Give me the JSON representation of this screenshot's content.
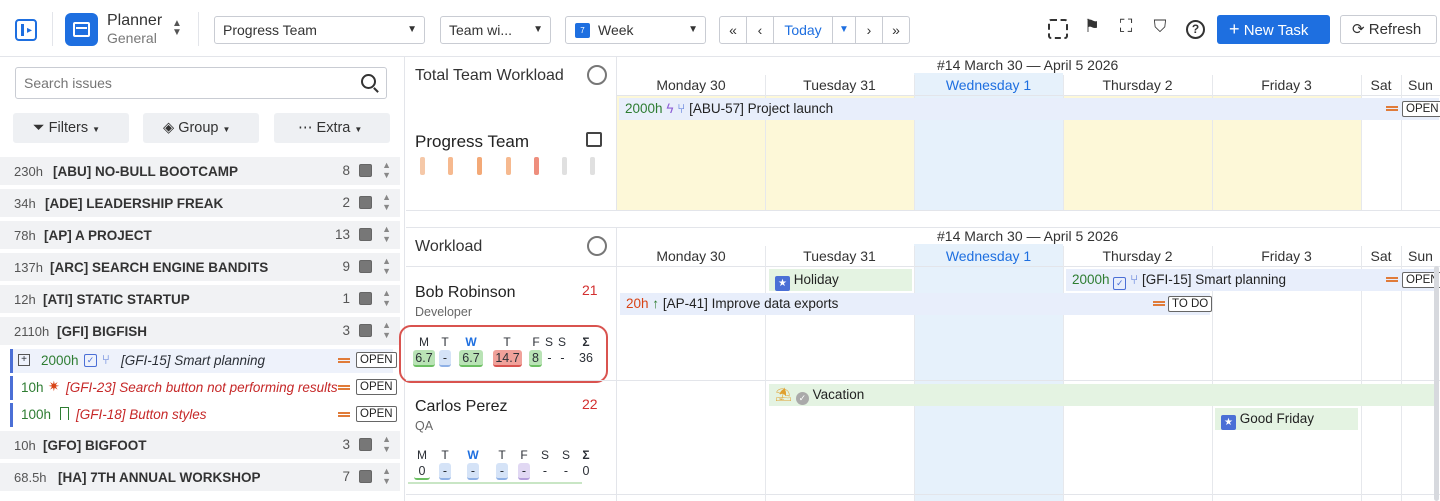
{
  "app": {
    "title": "Planner",
    "subtitle": "General"
  },
  "toolbar": {
    "team_select": "Progress Team",
    "view_select": "Team wi...",
    "period_select": "Week",
    "today": "Today",
    "new_task": "New Task",
    "refresh": "Refresh"
  },
  "sidebar": {
    "search_placeholder": "Search issues",
    "filters": "Filters",
    "group": "Group",
    "extra": "Extra",
    "projects": [
      {
        "hours": "230h",
        "name": "[ABU] NO-BULL BOOTCAMP",
        "count": "8"
      },
      {
        "hours": "34h",
        "name": "[ADE] LEADERSHIP FREAK",
        "count": "2"
      },
      {
        "hours": "78h",
        "name": "[AP] A PROJECT",
        "count": "13"
      },
      {
        "hours": "137h",
        "name": "[ARC] SEARCH ENGINE BANDITS",
        "count": "9"
      },
      {
        "hours": "12h",
        "name": "[ATI] STATIC STARTUP",
        "count": "1"
      },
      {
        "hours": "2110h",
        "name": "[GFI] BIGFISH",
        "count": "3"
      }
    ],
    "tasks": [
      {
        "hours": "2000h",
        "title": "[GFI-15] Smart planning",
        "status": "OPEN"
      },
      {
        "hours": "10h",
        "title": "[GFI-23] Search button not performing results",
        "status": "OPEN"
      },
      {
        "hours": "100h",
        "title": "[GFI-18] Button styles",
        "status": "OPEN"
      }
    ],
    "projects2": [
      {
        "hours": "10h",
        "name": "[GFO] BIGFOOT",
        "count": "3"
      },
      {
        "hours": "68.5h",
        "name": "[HA] 7TH ANNUAL WORKSHOP",
        "count": "7"
      }
    ]
  },
  "calendar": {
    "week_label": "#14 March 30 — April 5 2026",
    "days": [
      "Monday 30",
      "Tuesday 31",
      "Wednesday 1",
      "Thursday 2",
      "Friday 3",
      "Sat",
      "Sun"
    ],
    "total_label": "Total Team Workload",
    "team_name": "Progress Team",
    "workload_label": "Workload",
    "team_event": {
      "hours": "2000h",
      "title": "[ABU-57] Project launch",
      "status": "OPEN"
    }
  },
  "people": [
    {
      "name": "Bob Robinson",
      "role": "Developer",
      "count": "21",
      "days": [
        "M",
        "T",
        "W",
        "T",
        "F",
        "S",
        "S",
        "Σ"
      ],
      "values": [
        "6.7",
        "-",
        "6.7",
        "14.7",
        "8",
        "-",
        "-",
        "36"
      ],
      "events": {
        "holiday": "Holiday",
        "smart": {
          "hours": "2000h",
          "title": "[GFI-15] Smart planning",
          "status": "OPEN"
        },
        "export": {
          "hours": "20h",
          "title": "[AP-41] Improve data exports",
          "status": "TO DO"
        }
      }
    },
    {
      "name": "Carlos Perez",
      "role": "QA",
      "count": "22",
      "days": [
        "M",
        "T",
        "W",
        "T",
        "F",
        "S",
        "S",
        "Σ"
      ],
      "values": [
        "0",
        "-",
        "-",
        "-",
        "-",
        "-",
        "-",
        "0"
      ],
      "events": {
        "vacation": "Vacation",
        "good_friday": "Good Friday"
      }
    }
  ],
  "colors": {
    "accent": "#1e6fe0",
    "today_bg": "#e6f1fb",
    "weekday_bg": "#fdf8d8"
  }
}
